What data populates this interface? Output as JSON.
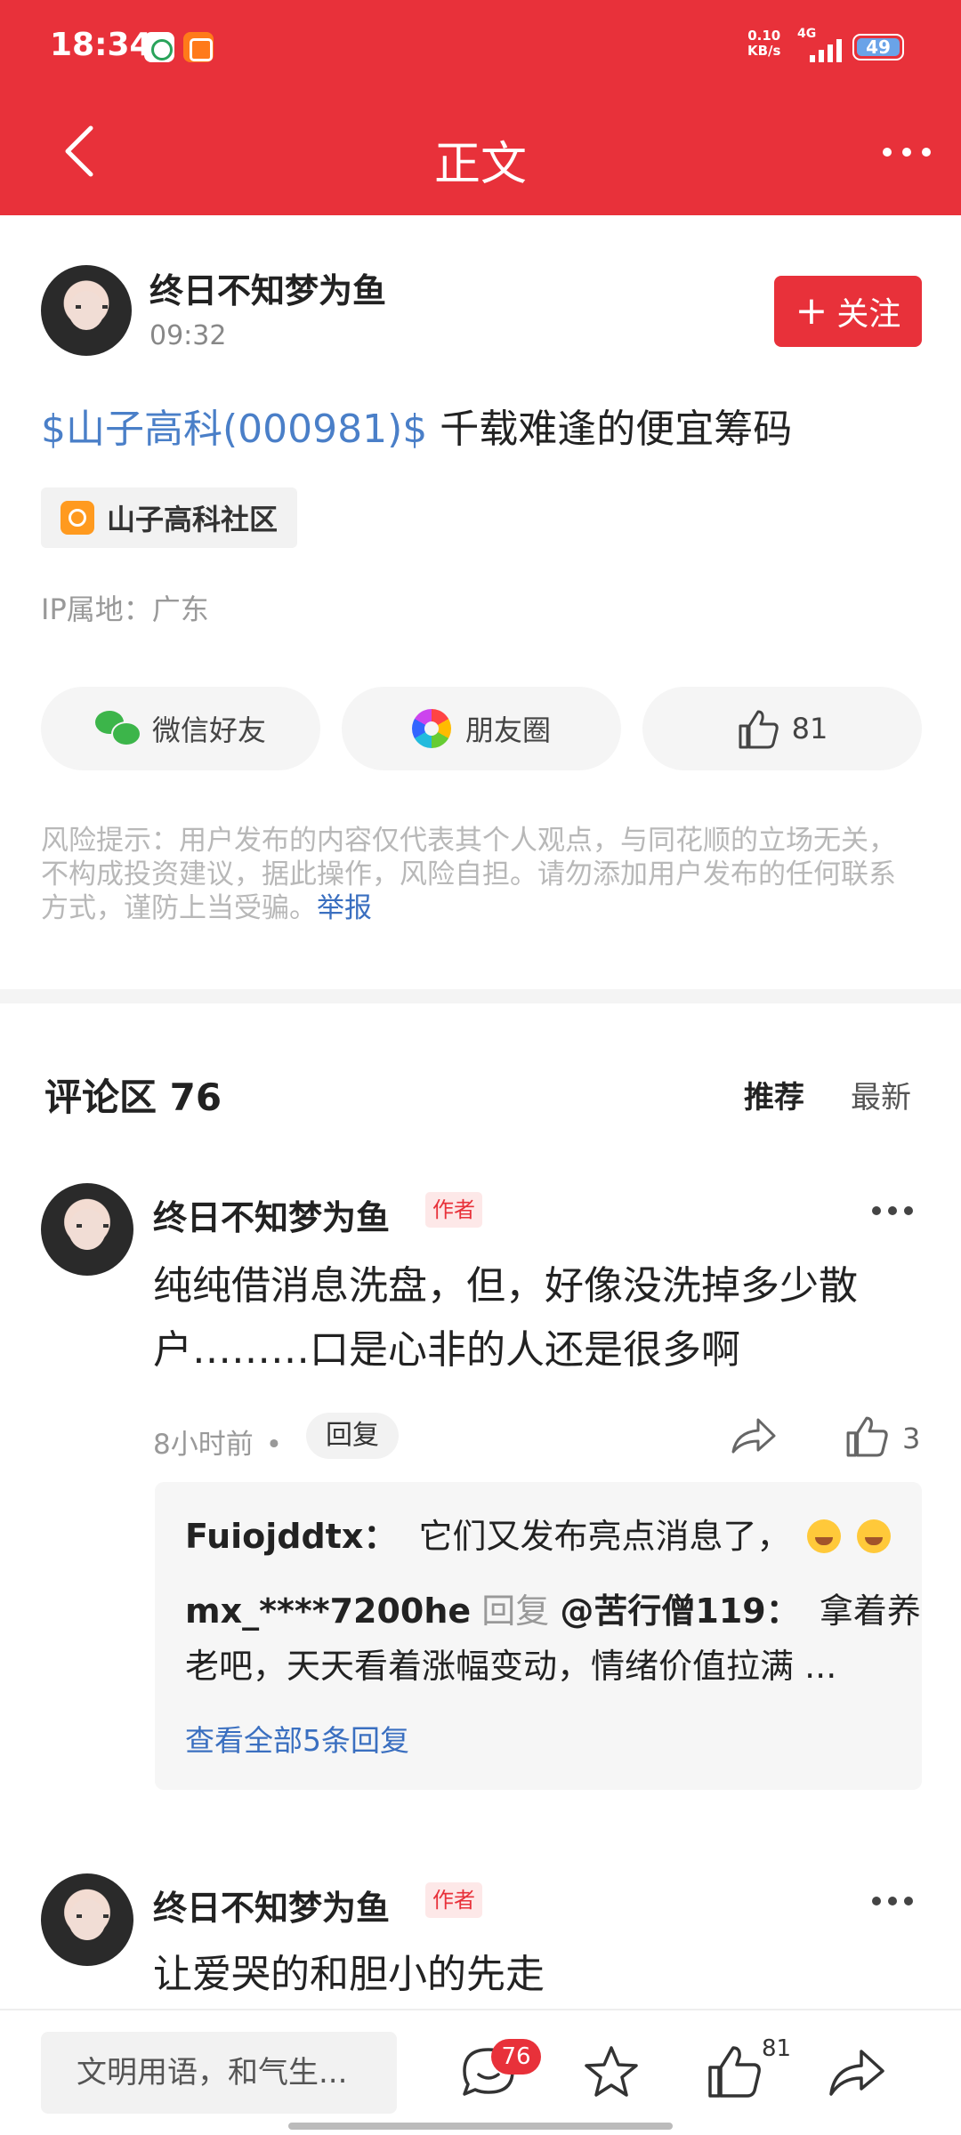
{
  "status_bar": {
    "time": "18:34",
    "net_speed": "0.10",
    "net_unit": "KB/s",
    "network": "4G",
    "battery": "49"
  },
  "header": {
    "title": "正文"
  },
  "post": {
    "author": "终日不知梦为鱼",
    "time": "09:32",
    "follow_label": "关注",
    "stock": "$山子高科(000981)$",
    "title": "千载难逢的便宜筹码",
    "community": "山子高科社区",
    "ip": "IP属地：广东",
    "share": {
      "wechat": "微信好友",
      "moments": "朋友圈",
      "likes": "81"
    },
    "risk_notice": "风险提示：用户发布的内容仅代表其个人观点，与同花顺的立场无关，不构成投资建议，据此操作，风险自担。请勿添加用户发布的任何联系方式，谨防上当受骗。",
    "report": "举报"
  },
  "comments": {
    "header": "评论区 76",
    "sort_recommended": "推荐",
    "sort_latest": "最新",
    "items": [
      {
        "author": "终日不知梦为鱼",
        "badge": "作者",
        "text_line1": "纯纯借消息洗盘，但，好像没洗掉多少散",
        "text_line2": "户………口是心非的人还是很多啊",
        "time": "8小时前",
        "reply_label": "回复",
        "likes": "3",
        "replies": [
          {
            "user": "Fuiojddtx：",
            "text": "它们又发布亮点消息了，"
          },
          {
            "user": "mx_****7200he",
            "verb": "回复",
            "target": "@苦行僧119：",
            "text_line1": "拿着养",
            "text_line2": "老吧，天天看着涨幅变动，情绪价值拉满 ..."
          }
        ],
        "view_all": "查看全部5条回复"
      },
      {
        "author": "终日不知梦为鱼",
        "badge": "作者",
        "text_line1": "让爱哭的和胆小的先走"
      }
    ]
  },
  "bottom_bar": {
    "input_placeholder": "文明用语，和气生...",
    "comment_count": "76",
    "like_count": "81"
  },
  "colors": {
    "brand_red": "#e8313a",
    "link_blue": "#3a6fc0",
    "stock_blue": "#4a7fc8"
  }
}
